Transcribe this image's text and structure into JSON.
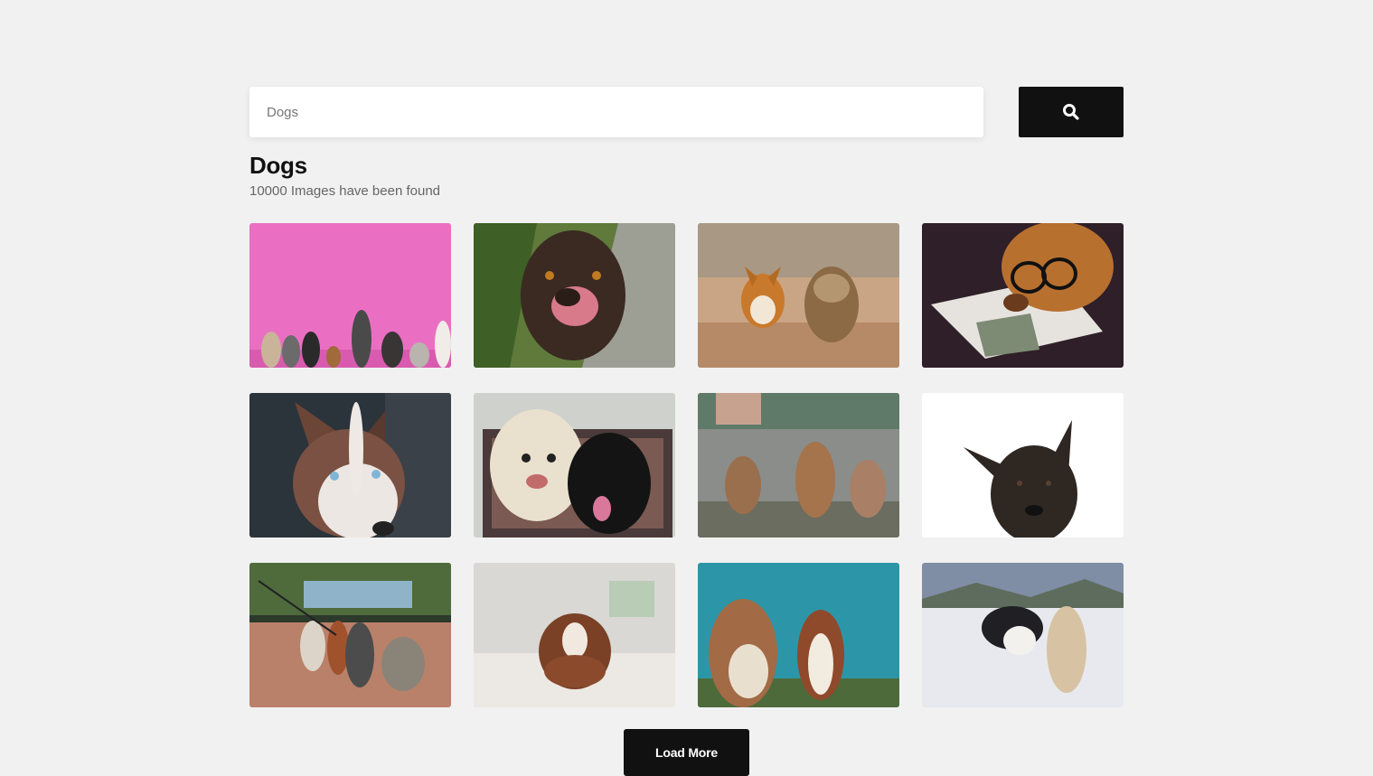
{
  "search": {
    "value": "",
    "placeholder": "Dogs",
    "button_icon": "search-icon"
  },
  "results": {
    "title": "Dogs",
    "count_text": "10000 Images have been found"
  },
  "images": [
    {
      "subject": "dogs lined up against pink wall"
    },
    {
      "subject": "brown labrador licking nose"
    },
    {
      "subject": "corgi and yorkie running on path"
    },
    {
      "subject": "dog with glasses reading magazine"
    },
    {
      "subject": "husky with blue eyes"
    },
    {
      "subject": "white doodle and black lab on rug"
    },
    {
      "subject": "three puppies on gravel"
    },
    {
      "subject": "dark shepherd on white background"
    },
    {
      "subject": "pack of dogs on leashes in park"
    },
    {
      "subject": "brown cockapoo puppy on bed"
    },
    {
      "subject": "two dogs looking up at sky"
    },
    {
      "subject": "husky and golden dog playing in snow"
    }
  ],
  "load_more": {
    "label": "Load More"
  },
  "colors": {
    "background": "#f1f1f1",
    "button": "#111111",
    "text_primary": "#111111",
    "text_secondary": "#666666"
  }
}
